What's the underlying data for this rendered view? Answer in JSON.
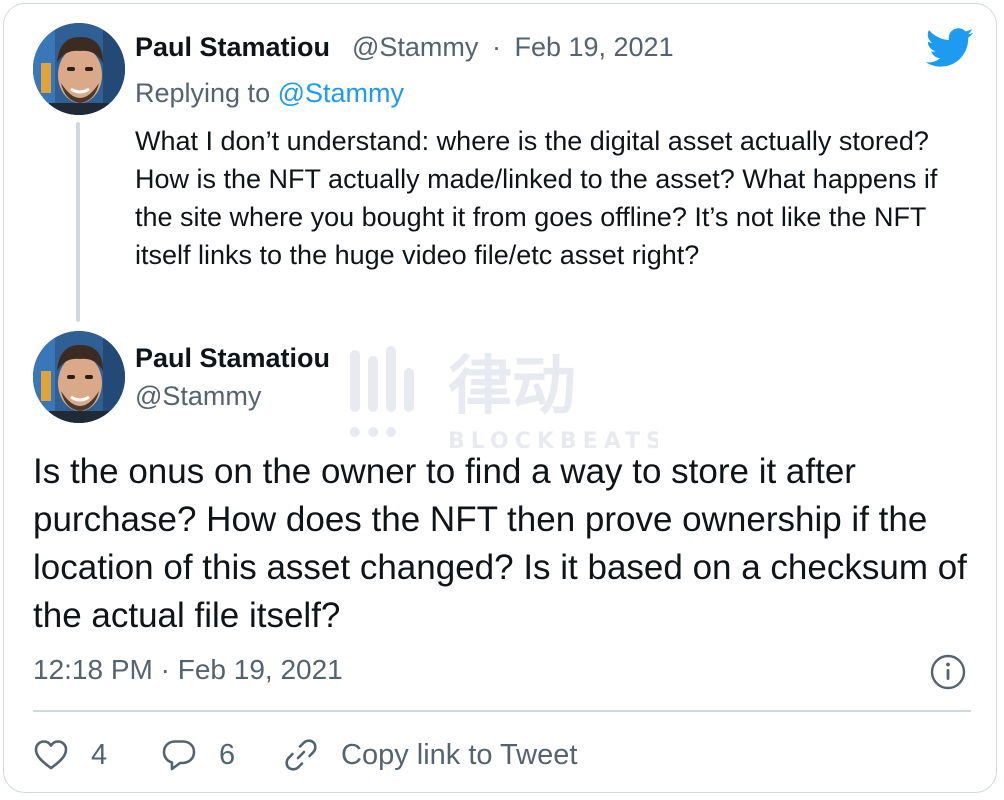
{
  "reply_tweet": {
    "author_name": "Paul Stamatiou",
    "author_handle": "@Stammy",
    "separator": "·",
    "date": "Feb 19, 2021",
    "replying_prefix": "Replying to",
    "replying_to": "@Stammy",
    "text": "What I don’t understand: where is the digital asset actually stored? How is the NFT actually made/linked to the asset? What happens if the site where you bought it from goes offline? It’s not like the NFT itself links to the huge video file/etc asset right?"
  },
  "main_tweet": {
    "author_name": "Paul Stamatiou",
    "author_handle": "@Stammy",
    "text": "Is the onus on the owner to find a way to store it after purchase? How does the NFT then prove ownership if the location of this asset changed? Is it based on a checksum of the actual file itself?",
    "timestamp": "12:18 PM · Feb 19, 2021"
  },
  "actions": {
    "likes": "4",
    "replies": "6",
    "copy_link_label": "Copy link to Tweet"
  },
  "watermark": {
    "brand_cn": "律动",
    "brand_en": "BLOCKBEATS"
  },
  "icons": {
    "logo": "twitter-bird-icon",
    "info": "info-icon",
    "like": "heart-icon",
    "reply": "reply-bubble-icon",
    "link": "link-icon"
  },
  "colors": {
    "accent": "#1d9bf0",
    "text": "#0f1419",
    "secondary": "#536471",
    "border": "#cfd9de"
  }
}
